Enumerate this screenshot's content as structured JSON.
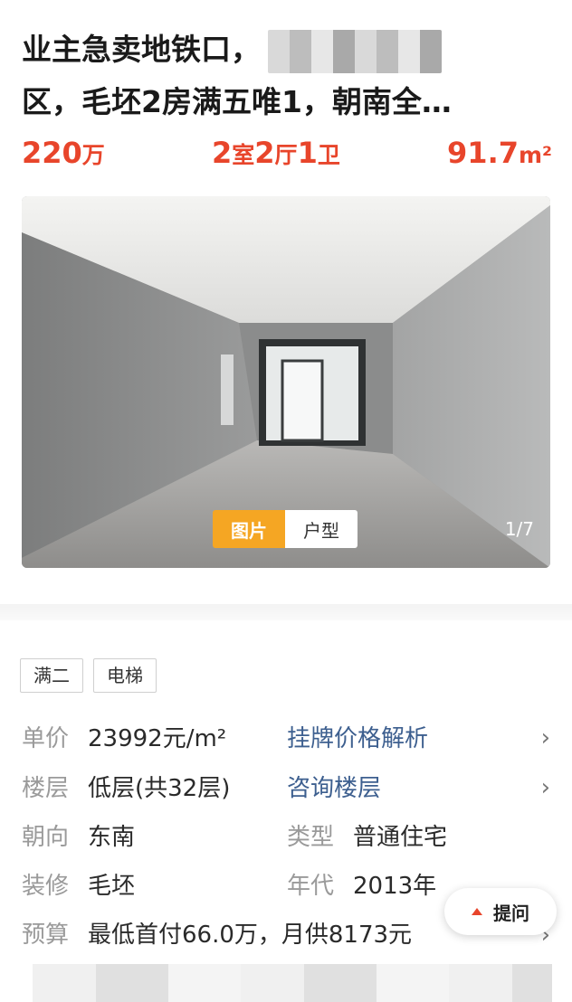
{
  "listing": {
    "title_line1": "业主急卖地铁口，",
    "title_line2": "区，毛坯2房满五唯1，朝南全…",
    "price_value": "220",
    "price_unit": "万",
    "layout": {
      "rooms": "2",
      "rooms_unit": "室",
      "halls": "2",
      "halls_unit": "厅",
      "baths": "1",
      "baths_unit": "卫"
    },
    "area_value": "91.7",
    "area_unit": "m²"
  },
  "gallery": {
    "tabs": [
      {
        "label": "图片",
        "active": true
      },
      {
        "label": "户型",
        "active": false
      }
    ],
    "counter": "1/7"
  },
  "tags": [
    "满二",
    "电梯"
  ],
  "details": {
    "unit_price": {
      "label": "单价",
      "value": "23992元/m²",
      "link": "挂牌价格解析"
    },
    "floor": {
      "label": "楼层",
      "value": "低层(共32层)",
      "link": "咨询楼层"
    },
    "orientation": {
      "label": "朝向",
      "value": "东南"
    },
    "type": {
      "label": "类型",
      "value": "普通住宅"
    },
    "decoration": {
      "label": "装修",
      "value": "毛坯"
    },
    "year": {
      "label": "年代",
      "value": "2013年"
    },
    "budget": {
      "label": "预算",
      "value": "最低首付66.0万，月供8173元"
    }
  },
  "ask_button": {
    "label": "提问",
    "icon": "caret-up-icon"
  },
  "colors": {
    "price": "#e8452b",
    "tab_active": "#f5a623",
    "link": "#3d5f8f",
    "label": "#9a9a9a"
  }
}
